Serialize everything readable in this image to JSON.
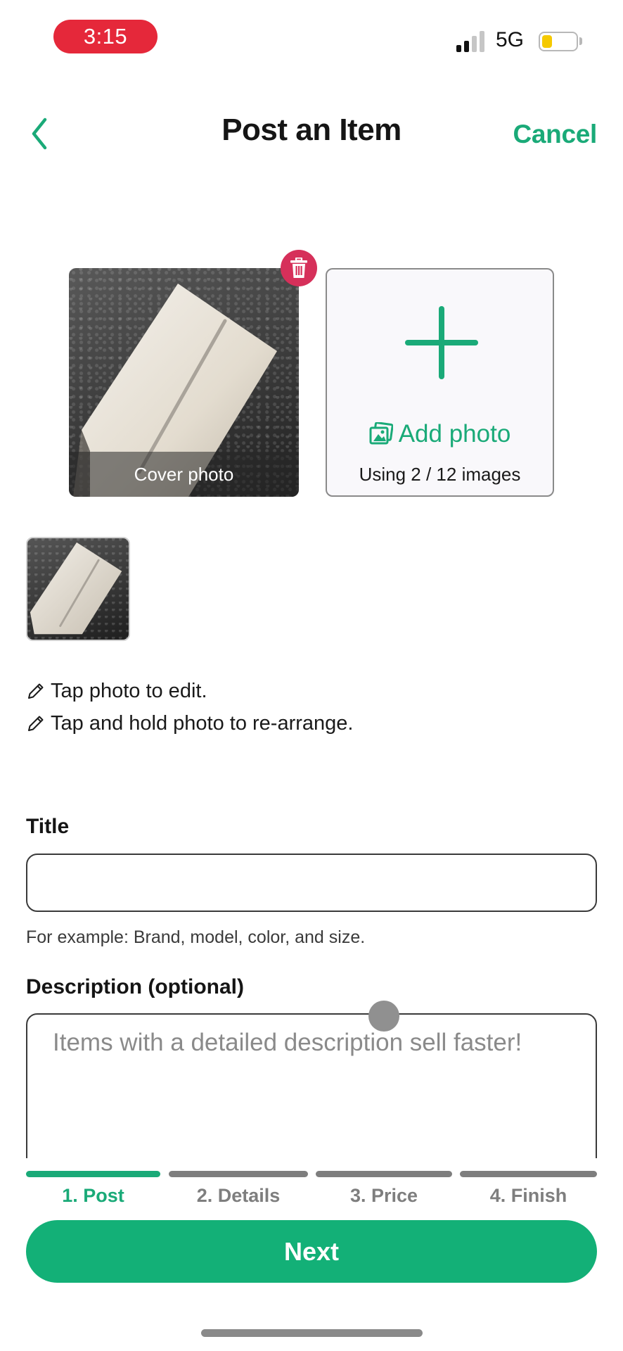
{
  "status_bar": {
    "time": "3:15",
    "network": "5G",
    "battery_level_percent": 30,
    "signal_bars_filled": 2,
    "signal_bars_total": 4
  },
  "nav": {
    "back_icon": "chevron-left-icon",
    "title": "Post an Item",
    "cancel_label": "Cancel"
  },
  "photos": {
    "cover_caption": "Cover photo",
    "delete_icon": "trash-icon",
    "add_photo_label": "Add photo",
    "add_photo_icon": "images-icon",
    "usage_text": "Using 2 / 12 images",
    "images_used": 2,
    "images_max": 12
  },
  "hints": [
    {
      "icon": "pencil-icon",
      "text": "Tap photo to edit."
    },
    {
      "icon": "pencil-icon",
      "text": "Tap and hold photo to re-arrange."
    }
  ],
  "form": {
    "title_label": "Title",
    "title_value": "",
    "title_helper": "For example: Brand, model, color, and size.",
    "description_label": "Description (optional)",
    "description_value": "",
    "description_placeholder": "Items with a detailed description sell faster!"
  },
  "stepper": {
    "current_step": 1,
    "steps": [
      {
        "label": "1. Post"
      },
      {
        "label": "2. Details"
      },
      {
        "label": "3. Price"
      },
      {
        "label": "4. Finish"
      }
    ]
  },
  "footer": {
    "next_label": "Next"
  },
  "colors": {
    "accent": "#13b077",
    "accent_text": "#1aaa78",
    "inactive": "#7e7e7e",
    "delete": "#d6305a",
    "recording_pill": "#e5283a",
    "battery": "#f5c900"
  }
}
